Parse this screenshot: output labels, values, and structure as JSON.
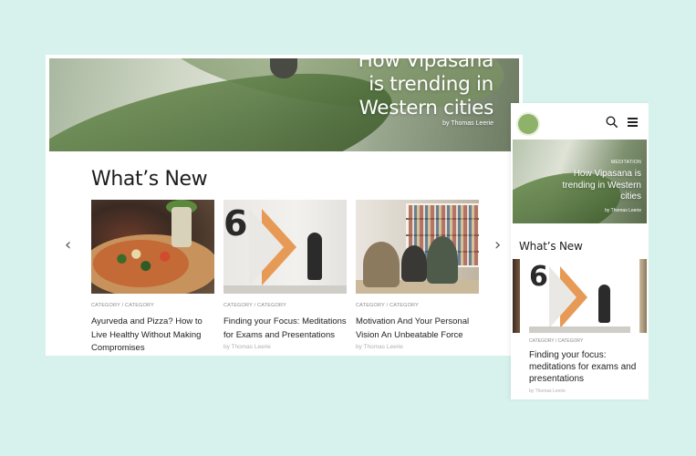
{
  "desktop": {
    "hero": {
      "title_lines": [
        "How Vipasana",
        "is trending in",
        "Western cities"
      ],
      "byline": "by Thomas Leerie"
    },
    "section_title": "What’s New",
    "nav": {
      "prev_icon": "‹",
      "next_icon": "›"
    },
    "cards": [
      {
        "category": "CATEGORY / CATEGORY",
        "title": "Ayurveda and Pizza? How to Live Healthy Without Making Compromises",
        "byline": ""
      },
      {
        "category": "CATEGORY / CATEGORY",
        "title": "Finding your Focus: Meditations for Exams and Presentations",
        "byline": "by Thomas Leerie"
      },
      {
        "category": "CATEGORY / CATEGORY",
        "title": "Motivation And Your Personal Vision An Unbeatable Force",
        "byline": "by Thomas Leerie"
      }
    ]
  },
  "mobile": {
    "hero": {
      "kicker": "MEDITATION",
      "title": "How Vipasana is trending in Western cities",
      "byline": "by Thomas Leerie"
    },
    "section_title": "What’s New",
    "card": {
      "category": "CATEGORY / CATEGORY",
      "title": "Finding your focus: meditations for exams and presentations",
      "byline": "by Thomas Leerie"
    },
    "icons": {
      "search": "search-icon",
      "menu": "hamburger-menu-icon"
    }
  },
  "colors": {
    "background": "#d7f1ec",
    "logo": "#8fb26b",
    "accent_orange": "#e79a55"
  }
}
